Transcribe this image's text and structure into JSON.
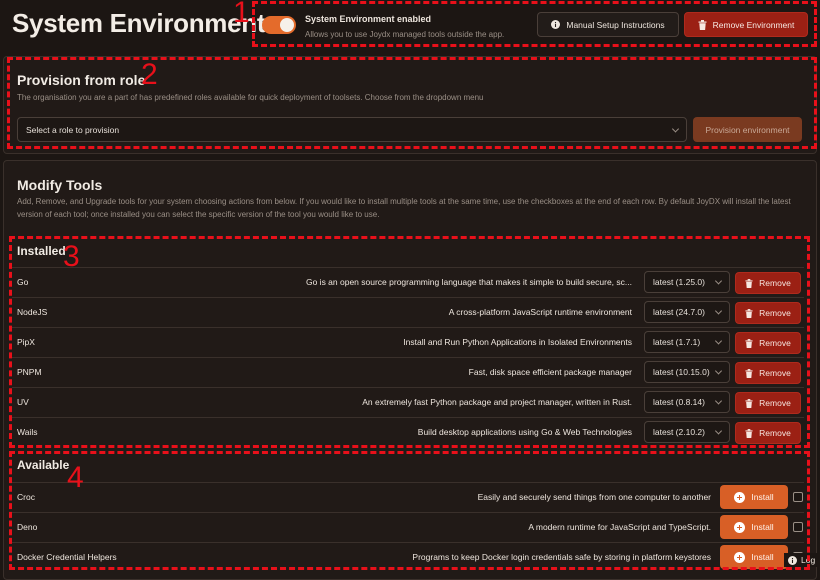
{
  "header": {
    "title": "System Environment",
    "toggle_on": true,
    "env_title": "System Environment enabled",
    "env_subtitle": "Allows you to use Joydx managed tools outside the app.",
    "manual_setup_label": "Manual Setup Instructions",
    "remove_env_label": "Remove Environment"
  },
  "provision": {
    "title": "Provision from role",
    "description": "The organisation you are a part of has predefined roles available for quick deployment of toolsets. Choose from the dropdown menu",
    "select_value": "Select a role to provision",
    "button_label": "Provision environment"
  },
  "modify": {
    "title": "Modify Tools",
    "description": "Add, Remove, and Upgrade tools for your system choosing actions from below. If you would like to install multiple tools at the same time, use the checkboxes at the end of each row. By default JoyDX will install the latest version of each tool; once installed you can select the specific version of the tool you would like to use."
  },
  "installed": {
    "label": "Installed",
    "remove_label": "Remove",
    "rows": [
      {
        "name": "Go",
        "description": "Go is an open source programming language that makes it simple to build secure, sc...",
        "version": "latest (1.25.0)"
      },
      {
        "name": "NodeJS",
        "description": "A cross-platform JavaScript runtime environment",
        "version": "latest (24.7.0)"
      },
      {
        "name": "PipX",
        "description": "Install and Run Python Applications in Isolated Environments",
        "version": "latest (1.7.1)"
      },
      {
        "name": "PNPM",
        "description": "Fast, disk space efficient package manager",
        "version": "latest (10.15.0)"
      },
      {
        "name": "UV",
        "description": "An extremely fast Python package and project manager, written in Rust.",
        "version": "latest (0.8.14)"
      },
      {
        "name": "Wails",
        "description": "Build desktop applications using Go & Web Technologies",
        "version": "latest (2.10.2)"
      }
    ]
  },
  "available": {
    "label": "Available",
    "install_label": "Install",
    "rows": [
      {
        "name": "Croc",
        "description": "Easily and securely send things from one computer to another"
      },
      {
        "name": "Deno",
        "description": "A modern runtime for JavaScript and TypeScript."
      },
      {
        "name": "Docker Credential Helpers",
        "description": "Programs to keep Docker login credentials safe by storing in platform keystores"
      }
    ]
  },
  "log_label": "Log",
  "annotations": [
    "1",
    "2",
    "3",
    "4"
  ],
  "colors": {
    "accent": "#d85f26",
    "danger": "#9b2014",
    "annotation": "#e8101a",
    "background": "#1c1613"
  }
}
